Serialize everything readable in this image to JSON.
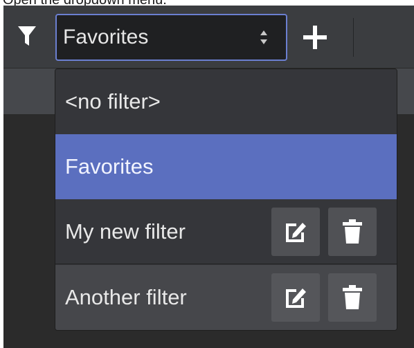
{
  "instruction": "Open the dropdown menu.",
  "toolbar": {
    "filter_icon": "filter-funnel-icon",
    "selected_filter": "Favorites",
    "add_icon": "plus-icon"
  },
  "dropdown": {
    "options": [
      {
        "label": "<no filter>",
        "selected": false,
        "editable": false
      },
      {
        "label": "Favorites",
        "selected": true,
        "editable": false
      },
      {
        "label": "My new filter",
        "selected": false,
        "editable": true
      },
      {
        "label": "Another filter",
        "selected": false,
        "editable": true
      }
    ],
    "edit_icon": "edit-icon",
    "delete_icon": "trash-icon"
  },
  "colors": {
    "background": "#2b2b2b",
    "toolbar": "#3b3d40",
    "accent": "#5b6fbf",
    "focus_border": "#6b7fd1",
    "text": "#e8e8e8"
  }
}
